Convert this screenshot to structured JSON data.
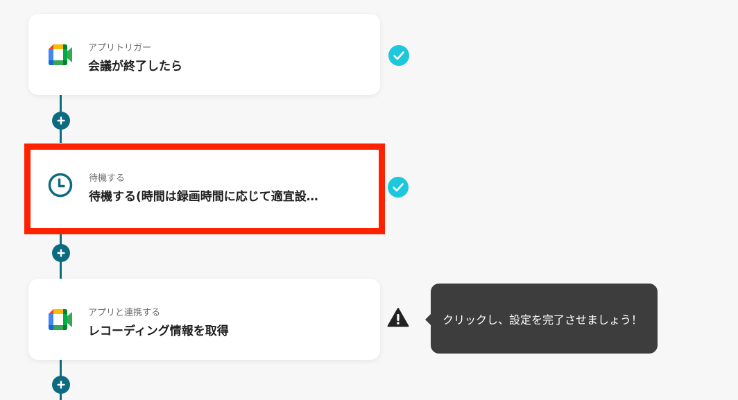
{
  "colors": {
    "background": "#f7f7f8",
    "connector": "#0d6b80",
    "highlight": "#ff2200",
    "check": "#1ec8dc",
    "tooltip_bg": "#3d3d3d"
  },
  "steps": [
    {
      "subtitle": "アプリトリガー",
      "title": "会議が終了したら",
      "icon": "google-meet-icon",
      "status": "completed-check-icon"
    },
    {
      "subtitle": "待機する",
      "title": "待機する(時間は録画時間に応じて適宜設…",
      "icon": "clock-icon",
      "status": "completed-check-icon",
      "highlighted": true
    },
    {
      "subtitle": "アプリと連携する",
      "title": "レコーディング情報を取得",
      "icon": "google-meet-icon",
      "status": "warning-icon"
    }
  ],
  "add_step_buttons": [
    "plus-icon",
    "plus-icon",
    "plus-icon"
  ],
  "tooltip": {
    "text": "クリックし、設定を完了させましょう！"
  }
}
